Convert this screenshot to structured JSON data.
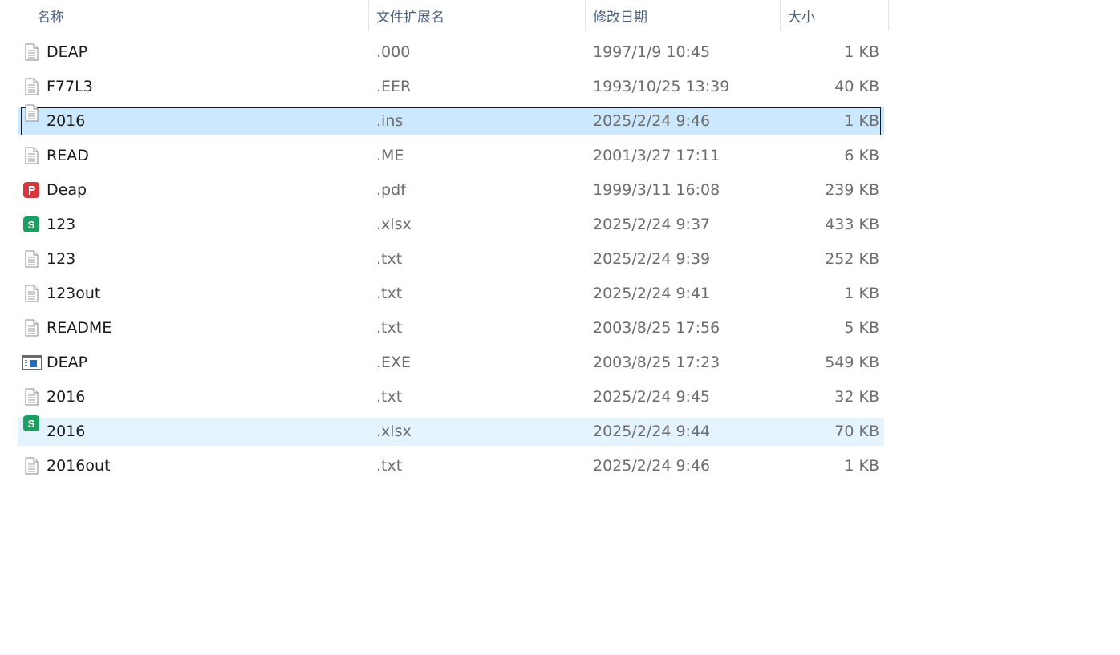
{
  "columns": {
    "name": "名称",
    "ext": "文件扩展名",
    "date": "修改日期",
    "size": "大小"
  },
  "files": [
    {
      "name": "DEAP",
      "ext": ".000",
      "date": "1997/1/9 10:45",
      "size": "1 KB",
      "icon": "document-icon",
      "state": "normal"
    },
    {
      "name": "F77L3",
      "ext": ".EER",
      "date": "1993/10/25 13:39",
      "size": "40 KB",
      "icon": "document-icon",
      "state": "normal"
    },
    {
      "name": "2016",
      "ext": ".ins",
      "date": "2025/2/24 9:46",
      "size": "1 KB",
      "icon": "document-icon",
      "state": "selected"
    },
    {
      "name": "READ",
      "ext": ".ME",
      "date": "2001/3/27 17:11",
      "size": "6 KB",
      "icon": "document-icon",
      "state": "normal"
    },
    {
      "name": "Deap",
      "ext": ".pdf",
      "date": "1999/3/11 16:08",
      "size": "239 KB",
      "icon": "pdf-icon",
      "state": "normal"
    },
    {
      "name": "123",
      "ext": ".xlsx",
      "date": "2025/2/24 9:37",
      "size": "433 KB",
      "icon": "spreadsheet-icon",
      "state": "normal"
    },
    {
      "name": "123",
      "ext": ".txt",
      "date": "2025/2/24 9:39",
      "size": "252 KB",
      "icon": "document-icon",
      "state": "normal"
    },
    {
      "name": "123out",
      "ext": ".txt",
      "date": "2025/2/24 9:41",
      "size": "1 KB",
      "icon": "document-icon",
      "state": "normal"
    },
    {
      "name": "README",
      "ext": ".txt",
      "date": "2003/8/25 17:56",
      "size": "5 KB",
      "icon": "document-icon",
      "state": "normal"
    },
    {
      "name": "DEAP",
      "ext": ".EXE",
      "date": "2003/8/25 17:23",
      "size": "549 KB",
      "icon": "executable-icon",
      "state": "normal"
    },
    {
      "name": "2016",
      "ext": ".txt",
      "date": "2025/2/24 9:45",
      "size": "32 KB",
      "icon": "document-icon",
      "state": "normal"
    },
    {
      "name": "2016",
      "ext": ".xlsx",
      "date": "2025/2/24 9:44",
      "size": "70 KB",
      "icon": "spreadsheet-icon",
      "state": "hover"
    },
    {
      "name": "2016out",
      "ext": ".txt",
      "date": "2025/2/24 9:46",
      "size": "1 KB",
      "icon": "document-icon",
      "state": "normal"
    }
  ],
  "colors": {
    "selected_bg": "#cce8ff",
    "hover_bg": "#e5f3ff",
    "pdf_red": "#d9363e",
    "spreadsheet_green": "#1e9e63",
    "exe_blue": "#1f6fc5"
  }
}
